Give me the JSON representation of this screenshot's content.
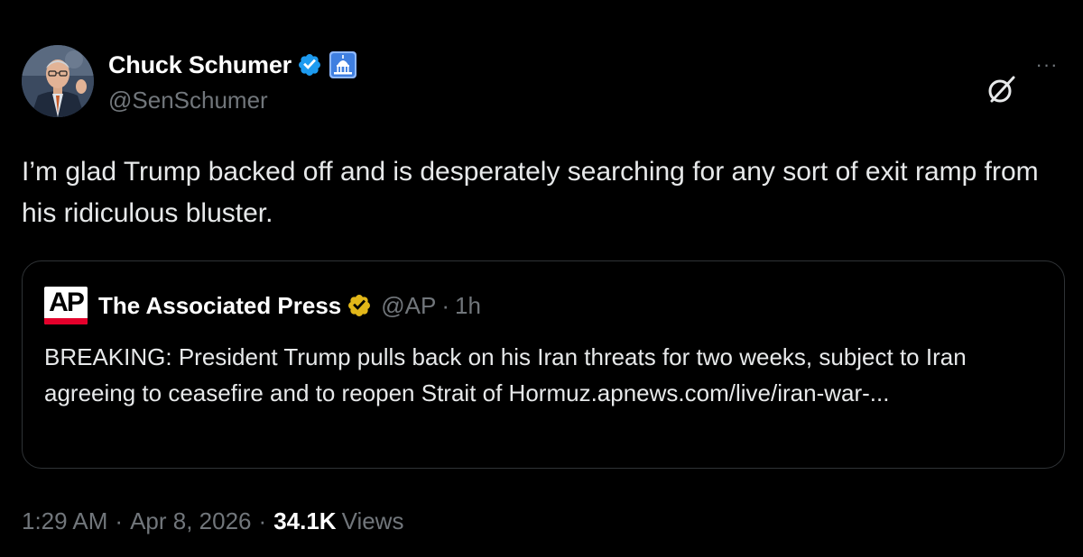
{
  "author": {
    "display_name": "Chuck Schumer",
    "handle": "@SenSchumer",
    "verified_icon": "blue-verified-badge",
    "affiliation_icon": "capitol-building-icon"
  },
  "actions": {
    "grok_icon": "grok-icon",
    "more_label": "···"
  },
  "tweet": {
    "text": "I’m glad Trump backed off and is desperately searching for any sort of exit ramp from his ridiculous bluster."
  },
  "quote": {
    "logo_text": "AP",
    "display_name": "The Associated Press",
    "verified_icon": "gold-verified-badge",
    "handle": "@AP",
    "separator": "·",
    "time": "1h",
    "text": "BREAKING: President Trump pulls back on his Iran threats for two weeks, subject to Iran agreeing to ceasefire and to reopen Strait of Hormuz.apnews.com/live/iran-war-..."
  },
  "meta": {
    "time": "1:29 AM",
    "separator": "·",
    "date": "Apr 8, 2026",
    "views_count": "34.1K",
    "views_label": "Views"
  },
  "colors": {
    "background": "#000000",
    "primary_text": "#e7e9ea",
    "secondary_text": "#71767b",
    "border": "#2f3336",
    "verified_blue": "#1d9bf0",
    "verified_gold": "#e2b719",
    "ap_red": "#e4002b"
  }
}
